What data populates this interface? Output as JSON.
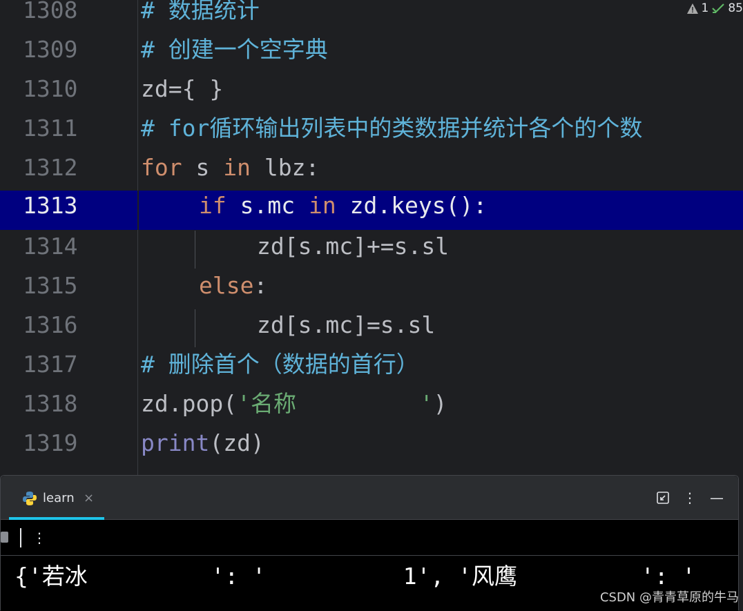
{
  "editor": {
    "lines": [
      {
        "number": "1308",
        "content": "# 数据统计"
      },
      {
        "number": "1309",
        "content": "# 创建一个空字典"
      },
      {
        "number": "1310",
        "content": "zd={ }"
      },
      {
        "number": "1311",
        "content": "# for循环输出列表中的类数据并统计各个的个数"
      },
      {
        "number": "1312",
        "content": "for s in lbz:"
      },
      {
        "number": "1313",
        "content": "if s.mc in zd.keys():"
      },
      {
        "number": "1314",
        "content": "zd[s.mc]+=s.sl"
      },
      {
        "number": "1315",
        "content": "else:"
      },
      {
        "number": "1316",
        "content": "zd[s.mc]=s.sl"
      },
      {
        "number": "1317",
        "content": "# 删除首个（数据的首行）"
      },
      {
        "number": "1318",
        "content": "zd.pop('名称         ')"
      },
      {
        "number": "1319",
        "content": "print(zd)"
      }
    ],
    "current_line": "1313",
    "tokens": {
      "hash": "#",
      "c1308": "数据统计",
      "c1309": "创建一个空字典",
      "c1311_kw": "for",
      "c1311_rest": "循环输出列表中的类数据并统计各个的个数",
      "c1317": "删除首个（数据的首行）",
      "zd_init": "zd={ }",
      "for_kw": "for",
      "in_kw": "in",
      "s_var": " s ",
      "lbz": " lbz:",
      "if_kw": "if",
      "s_mc": " s.mc ",
      "zd_keys": " zd.keys():",
      "aug_assign": "zd[s.mc]+=s.sl",
      "else_kw": "else",
      "colon": ":",
      "assign": "zd[s.mc]=s.sl",
      "pop_call": "zd.pop(",
      "pop_arg": "'名称         '",
      "close_paren": ")",
      "print_fn": "print",
      "print_args": "(zd)"
    },
    "inspection": {
      "warnings": "1",
      "ok": "85"
    }
  },
  "run_panel": {
    "tab_label": "learn",
    "tab_close": "×",
    "toolbar_more": "⋮",
    "header_more": "⋮",
    "header_minimize": "—",
    "console_output": "{'若冰         ': '          1', '风鹰         ': '"
  },
  "watermark": "CSDN @青青草原的牛马",
  "colors": {
    "background": "#1e1f22",
    "current_line": "#000080",
    "comment": "#5fb3d9",
    "keyword": "#cf8e6d",
    "string": "#6aab73",
    "builtin": "#8888c6",
    "tab_underline": "#1ec3e8"
  }
}
